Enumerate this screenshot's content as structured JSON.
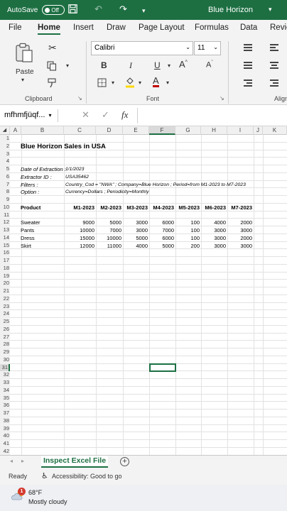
{
  "titlebar": {
    "autosave_label": "AutoSave",
    "autosave_state": "Off",
    "document_title": "Blue Horizon"
  },
  "menu": [
    "File",
    "Home",
    "Insert",
    "Draw",
    "Page Layout",
    "Formulas",
    "Data",
    "Revie"
  ],
  "ribbon": {
    "paste_label": "Paste",
    "clipboard_label": "Clipboard",
    "font_name": "Calibri",
    "font_size": "11",
    "font_label": "Font",
    "align_label": "Align",
    "bold": "B",
    "italic": "I",
    "underline": "U",
    "grow_font": "A",
    "shrink_font": "A",
    "font_color": "A",
    "accent_color": "#c00000"
  },
  "formula_bar": {
    "name_box": "mfhmfjüqf...",
    "fx": "fx"
  },
  "columns": [
    "A",
    "B",
    "C",
    "D",
    "E",
    "F",
    "G",
    "H",
    "I",
    "J",
    "K"
  ],
  "rows": [
    "1",
    "2",
    "3",
    "4",
    "5",
    "6",
    "7",
    "8",
    "9",
    "10",
    "11",
    "12",
    "13",
    "14",
    "15",
    "16",
    "17",
    "18",
    "19",
    "20",
    "21",
    "22",
    "23",
    "24",
    "25",
    "26",
    "27",
    "28",
    "29",
    "30",
    "31",
    "32",
    "33",
    "34",
    "35",
    "36",
    "37",
    "38",
    "39",
    "40",
    "41",
    "42"
  ],
  "sheet": {
    "title": "Blue Horizon Sales in USA",
    "meta": [
      {
        "label": "Date of Extraction :",
        "value": "1/1/2023"
      },
      {
        "label": "Extractor ID :",
        "value": "USA35462"
      },
      {
        "label": "Filters :",
        "value": "Country_Cod = \"NWA\" ; Company=Blue Horizon ; Period=from M1-2023 to M7-2023"
      },
      {
        "label": "Option :",
        "value": "Currency=Dollars ; Periodicity=Monthly"
      }
    ],
    "header": [
      "Product",
      "M1-2023",
      "M2-2023",
      "M3-2023",
      "M4-2023",
      "M5-2023",
      "M6-2023",
      "M7-2023"
    ],
    "data": [
      [
        "Sweater",
        "9000",
        "5000",
        "3000",
        "6000",
        "100",
        "4000",
        "2000"
      ],
      [
        "Pants",
        "10000",
        "7000",
        "3000",
        "7000",
        "100",
        "3000",
        "3000"
      ],
      [
        "Dress",
        "15000",
        "10000",
        "5000",
        "6000",
        "100",
        "3000",
        "2000"
      ],
      [
        "Skirt",
        "12000",
        "11000",
        "4000",
        "5000",
        "200",
        "3000",
        "3000"
      ]
    ]
  },
  "sheet_tab": "Inspect Excel File",
  "status": {
    "ready": "Ready",
    "accessibility": "Accessibility: Good to go"
  },
  "taskbar": {
    "temperature": "68°F",
    "condition": "Mostly cloudy",
    "badge": "1"
  }
}
